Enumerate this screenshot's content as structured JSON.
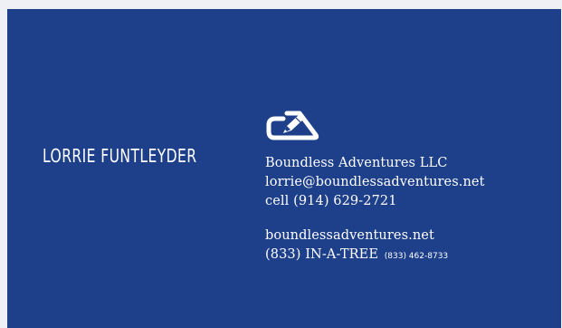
{
  "card": {
    "background_color": "#1e3f8a",
    "text_color": "#ffffff",
    "person_name": "LORRIE FUNTLEYDER",
    "logo_icon": "carabiner-pencil-icon",
    "company": "Boundless Adventures LLC",
    "email": "lorrie@boundlessadventures.net",
    "cell": "cell  (914) 629-2721",
    "website": "boundlessadventures.net",
    "vanity_phone": "(833) IN-A-TREE",
    "numeric_phone": "(833) 462-8733"
  }
}
